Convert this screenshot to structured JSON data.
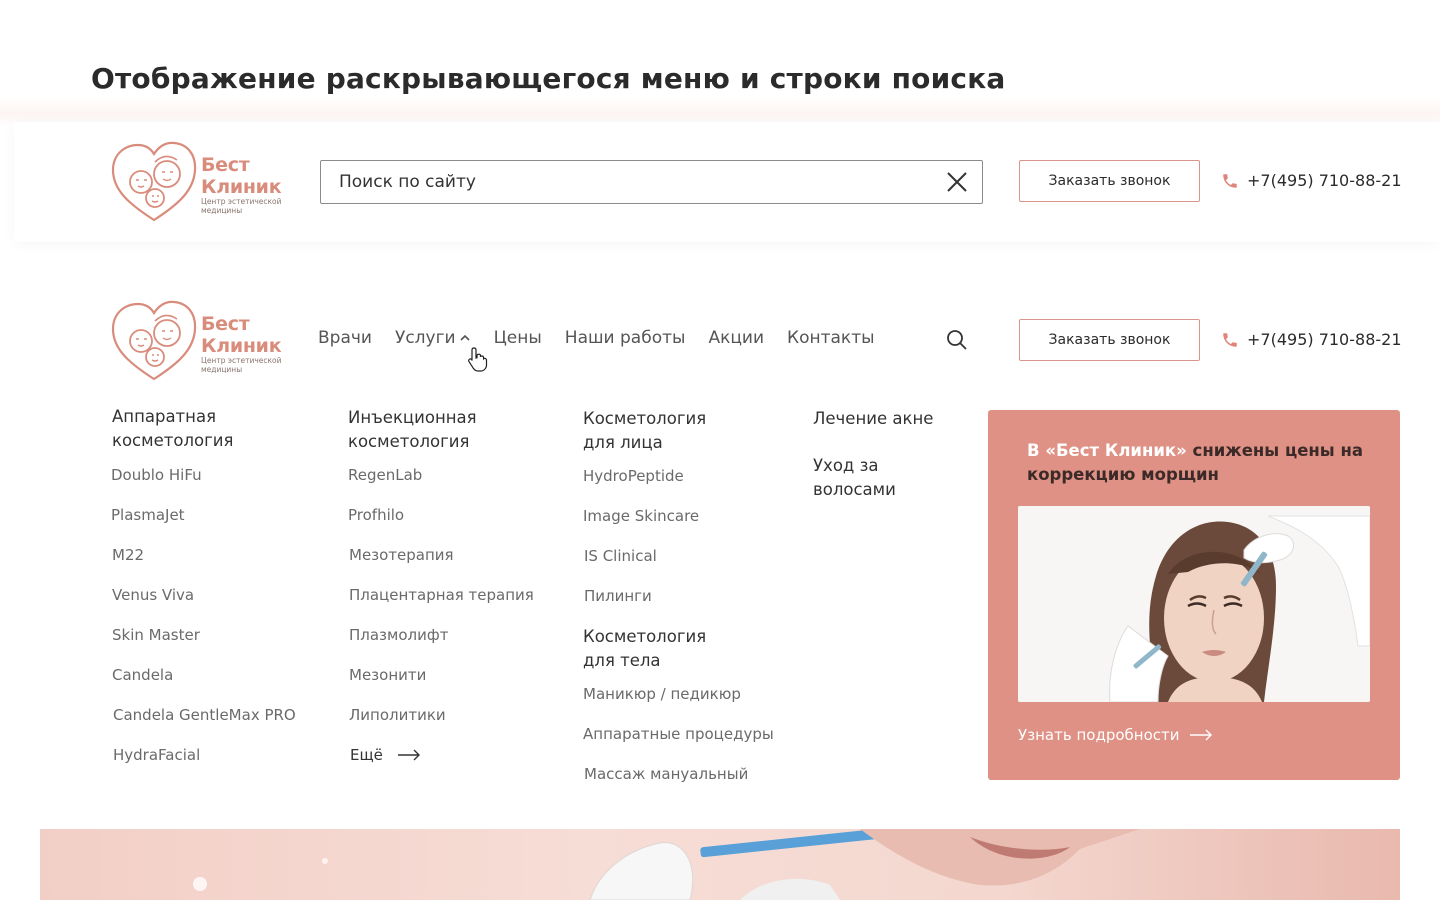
{
  "heading": "Отображение раскрывающегося меню и строки поиска",
  "logo": {
    "title_line1": "Бест",
    "title_line2": "Клиник",
    "subtitle_line1": "Центр эстетической",
    "subtitle_line2": "медицины"
  },
  "search": {
    "placeholder": "Поиск по сайту",
    "value": ""
  },
  "header": {
    "callback_label": "Заказать звонок",
    "phone": "+7(495) 710-88-21"
  },
  "nav": {
    "items": [
      {
        "label": "Врачи"
      },
      {
        "label": "Услуги"
      },
      {
        "label": "Цены"
      },
      {
        "label": "Наши работы"
      },
      {
        "label": "Акции"
      },
      {
        "label": "Контакты"
      }
    ]
  },
  "menu": {
    "col1": {
      "heading_line1": "Аппаратная",
      "heading_line2": "косметология",
      "links": [
        "Doublo HiFu",
        "PlasmaJet",
        "M22",
        "Venus Viva",
        "Skin Master",
        "Candela",
        "Candela GentleMax PRO",
        "HydraFacial"
      ]
    },
    "col2": {
      "heading_line1": "Инъекционная",
      "heading_line2": "косметология",
      "links": [
        "RegenLab",
        "Profhilo",
        "Мезотерапия",
        "Плацентарная терапия",
        "Плазмолифт",
        "Мезонити",
        "Липолитики"
      ],
      "more": "Ещё"
    },
    "col3": {
      "heading_line1": "Косметология",
      "heading_line2": "для лица",
      "links": [
        "HydroPeptide",
        "Image Skincare",
        "IS Clinical",
        "Пилинги"
      ],
      "heading2_line1": "Косметология",
      "heading2_line2": "для тела",
      "links2": [
        "Маникюр / педикюр",
        "Аппаратные процедуры",
        "Массаж мануальный"
      ]
    },
    "col4": {
      "heading1": "Лечение акне",
      "heading2_line1": "Уход за",
      "heading2_line2": "волосами"
    }
  },
  "promo": {
    "text_part1": "В «Бест Клиник» ",
    "text_part2": "снижены цены на коррекцию морщин",
    "link": "Узнать подробности"
  },
  "colors": {
    "accent": "#d98c7b",
    "promo_bg": "#de9184",
    "button_border": "#d9948b",
    "text_dark": "#2b2b2b",
    "text_muted": "#6a6a6a"
  },
  "icons": {
    "clear": "close-icon",
    "search": "search-icon",
    "phone": "phone-icon",
    "chevron": "chevron-up-icon",
    "cursor": "hand-pointer-icon",
    "arrow": "arrow-right-icon"
  }
}
